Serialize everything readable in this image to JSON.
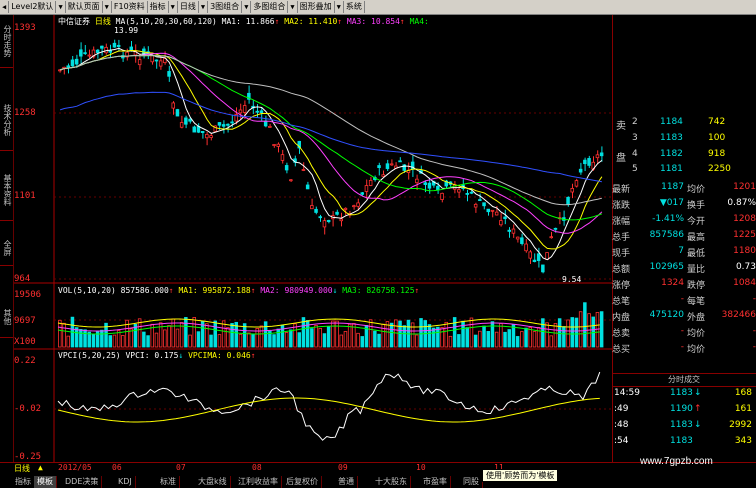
{
  "toolbar": {
    "items": [
      "Level2默认",
      "默认页面",
      "F10资料",
      "指标",
      "日线",
      "3图组合",
      "多图组合",
      "图形叠加",
      "系统"
    ]
  },
  "left_tabs": [
    "分时走势",
    "技术分析",
    "基本资料",
    "全屏",
    "其他"
  ],
  "main_chart": {
    "stock_name": "中信证券",
    "period": "日线",
    "ma_params": "MA(5,10,20,30,60,120)",
    "ma1_label": "MA1: 11.866",
    "ma2_label": "MA2: 11.410",
    "ma3_label": "MA3: 10.854",
    "ma4_label": "MA4:",
    "y_ticks": [
      "1393",
      "1258",
      "1101",
      "964"
    ],
    "high_label": "13.99",
    "low_label": "9.54"
  },
  "vol_chart": {
    "params": "VOL(5,10,20)",
    "vol_value": "857586.000",
    "ma1_label": "MA1: 995872.188",
    "ma2_label": "MA2: 980949.000",
    "ma3_label": "MA3: 826758.125",
    "y_ticks": [
      "19506",
      "9697",
      "X100"
    ]
  },
  "vpci_chart": {
    "params": "VPCI(5,20,25)",
    "vpci_label": "VPCI: 0.175",
    "vpcima_label": "VPCIMA: 0.046",
    "y_ticks": [
      "0.22",
      "-0.02",
      "-0.25"
    ]
  },
  "x_axis": {
    "labels": [
      "2012/05",
      "06",
      "07",
      "08",
      "09",
      "10",
      "11"
    ]
  },
  "order_book": {
    "sell_label": "卖",
    "buy_label": "盘",
    "rows": [
      {
        "n": "2",
        "price": "1184",
        "vol": "742"
      },
      {
        "n": "3",
        "price": "1183",
        "vol": "100"
      },
      {
        "n": "4",
        "price": "1182",
        "vol": "918"
      },
      {
        "n": "5",
        "price": "1181",
        "vol": "2250"
      }
    ]
  },
  "quote": [
    {
      "l1": "最新",
      "v1": "1187",
      "l2": "均价",
      "v2": "1201"
    },
    {
      "l1": "涨跌",
      "v1": "▼017",
      "l2": "换手",
      "v2": "0.87%"
    },
    {
      "l1": "涨幅",
      "v1": "-1.41%",
      "l2": "今开",
      "v2": "1208"
    },
    {
      "l1": "总手",
      "v1": "857586",
      "l2": "最高",
      "v2": "1225"
    },
    {
      "l1": "现手",
      "v1": "7",
      "l2": "最低",
      "v2": "1180"
    },
    {
      "l1": "总额",
      "v1": "102965",
      "l2": "量比",
      "v2": "0.73"
    },
    {
      "l1": "涨停",
      "v1": "1324",
      "l2": "跌停",
      "v2": "1084"
    },
    {
      "l1": "总笔",
      "v1": "-",
      "l2": "每笔",
      "v2": "-"
    },
    {
      "l1": "内盘",
      "v1": "475120",
      "l2": "外盘",
      "v2": "382466"
    },
    {
      "l1": "总卖",
      "v1": "-",
      "l2": "均价",
      "v2": "-"
    },
    {
      "l1": "总买",
      "v1": "-",
      "l2": "均价",
      "v2": "-"
    }
  ],
  "ticks": {
    "title": "分时成交",
    "rows": [
      {
        "t": "14:59",
        "p": "1183",
        "d": "↓",
        "v": "168"
      },
      {
        "t": ":49",
        "p": "1190",
        "d": "↑",
        "v": "161"
      },
      {
        "t": ":48",
        "p": "1183",
        "d": "↓",
        "v": "2992"
      },
      {
        "t": ":54",
        "p": "1183",
        "d": "",
        "v": "343"
      }
    ]
  },
  "bottom_tabs": [
    "指标",
    "模板",
    "DDE决策",
    "KDJ",
    "标准",
    "大盘k线",
    "江利收益率",
    "后复权价",
    "普通",
    "十大股东",
    "市盈率",
    "同股"
  ],
  "tooltip": "使用'顾势而为'模板",
  "period_tab": "日线",
  "watermark": "www.7gpzb.com"
}
